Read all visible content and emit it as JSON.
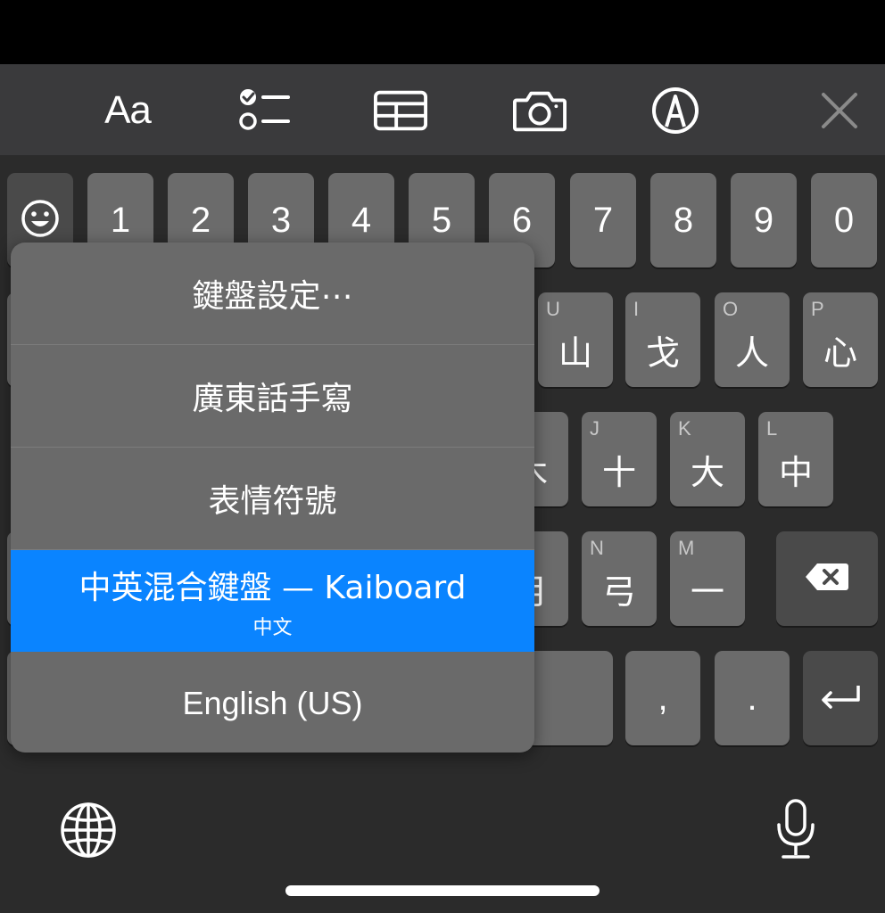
{
  "toolbar": {
    "format_label": "Aa",
    "icons": [
      "checklist-icon",
      "table-icon",
      "camera-icon",
      "markup-icon",
      "close-icon"
    ]
  },
  "keyboard": {
    "number_row": [
      "1",
      "2",
      "3",
      "4",
      "5",
      "6",
      "7",
      "8",
      "9",
      "0"
    ],
    "row2": [
      {
        "hint": "U",
        "char": "山"
      },
      {
        "hint": "I",
        "char": "戈"
      },
      {
        "hint": "O",
        "char": "人"
      },
      {
        "hint": "P",
        "char": "心"
      }
    ],
    "row3": [
      {
        "hint": "",
        "char": "木"
      },
      {
        "hint": "J",
        "char": "十"
      },
      {
        "hint": "K",
        "char": "大"
      },
      {
        "hint": "L",
        "char": "中"
      }
    ],
    "row4": [
      {
        "hint": "",
        "char": "月"
      },
      {
        "hint": "N",
        "char": "弓"
      },
      {
        "hint": "M",
        "char": "一"
      }
    ],
    "comma": ",",
    "period": "."
  },
  "popup": {
    "items": [
      {
        "label": "鍵盤設定⋯",
        "sub": ""
      },
      {
        "label": "廣東話手寫",
        "sub": ""
      },
      {
        "label": "表情符號",
        "sub": ""
      },
      {
        "label": "中英混合鍵盤 — Kaiboard",
        "sub": "中文"
      },
      {
        "label": "English (US)",
        "sub": ""
      }
    ],
    "selected_index": 3
  },
  "colors": {
    "accent": "#0a84ff",
    "key": "#6b6b6b",
    "key_dark": "#4a4a4a",
    "toolbar": "#3a3a3c",
    "keyboard_bg": "#2b2b2b"
  }
}
